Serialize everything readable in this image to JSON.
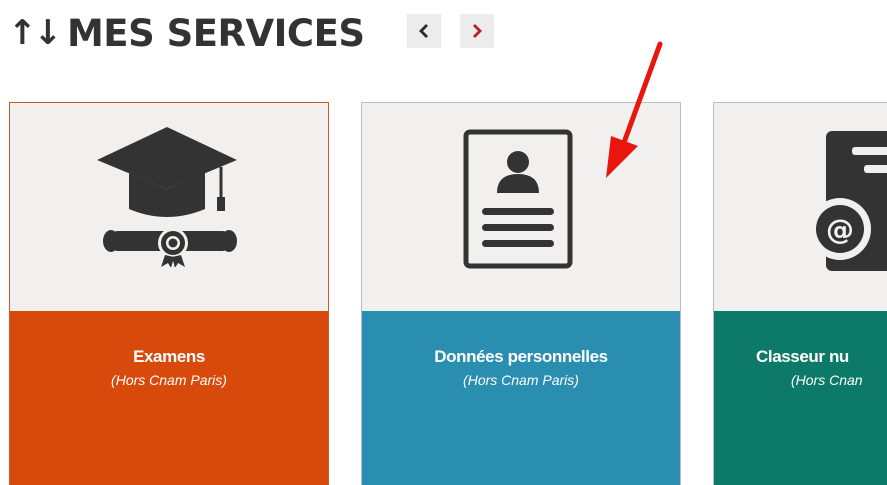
{
  "header": {
    "sort_icon": "↑↓",
    "title": "MES SERVICES",
    "prev_icon": "chevron-left-icon",
    "next_icon": "chevron-right-icon"
  },
  "cards": [
    {
      "title": "Examens",
      "subtitle": "(Hors Cnam Paris)",
      "icon": "graduation-cap-diploma-icon",
      "color": "#d84a0b"
    },
    {
      "title": "Données personnelles",
      "subtitle": "(Hors Cnam Paris)",
      "icon": "profile-document-icon",
      "color": "#2a8eb1"
    },
    {
      "title": "Classeur nu",
      "subtitle": "(Hors Cnan",
      "icon": "email-document-icon",
      "color": "#0d7a69"
    }
  ],
  "annotation": {
    "icon": "red-arrow-icon",
    "color": "#e8160c"
  },
  "colors": {
    "title": "#333333",
    "icon_bg": "#f1f0ef",
    "icon_fill": "#333333"
  }
}
